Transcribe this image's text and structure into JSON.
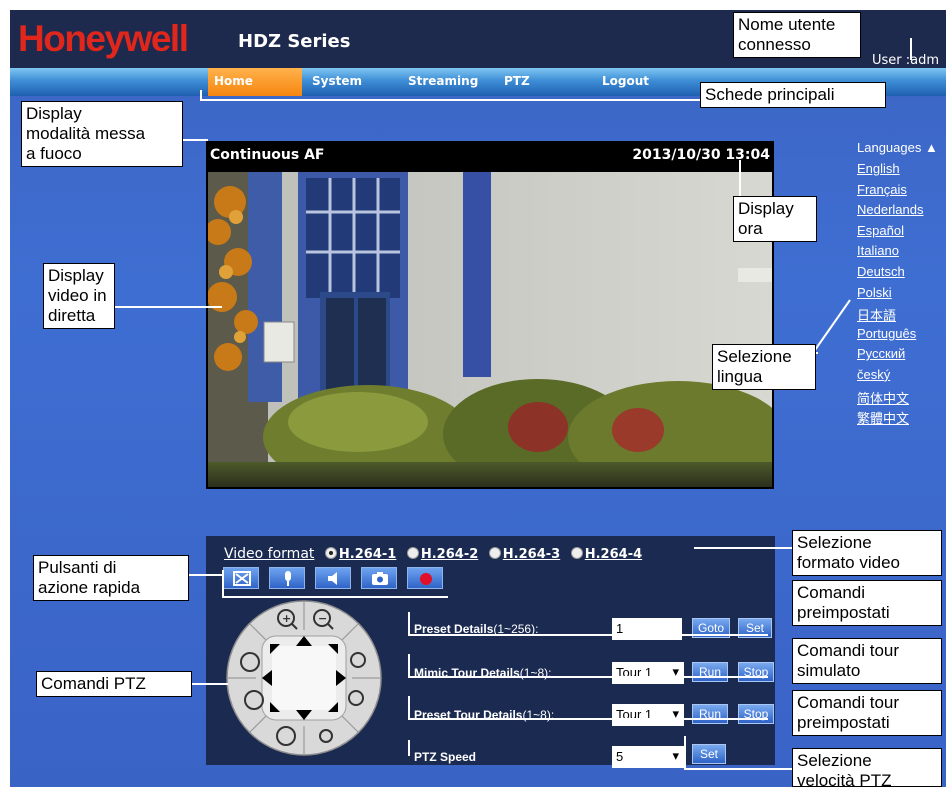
{
  "header": {
    "logo": "Honeywell",
    "series": "HDZ Series",
    "user": "User :adm"
  },
  "nav": {
    "tabs": [
      {
        "label": "Home",
        "active": true
      },
      {
        "label": "System"
      },
      {
        "label": "Streaming"
      },
      {
        "label": "PTZ"
      },
      {
        "label": "Logout"
      }
    ]
  },
  "video": {
    "focus_mode": "Continuous AF",
    "datetime": "2013/10/30 13:04"
  },
  "languages": {
    "title": "Languages",
    "items": [
      "English",
      "Français",
      "Nederlands",
      "Español",
      "Italiano",
      "Deutsch",
      "Polski",
      "日本語",
      "Português",
      "Русский",
      "český",
      "简体中文",
      "繁體中文"
    ]
  },
  "controls": {
    "video_format": {
      "label": "Video format",
      "options": [
        "H.264-1",
        "H.264-2",
        "H.264-3",
        "H.264-4"
      ],
      "selected": "H.264-1"
    },
    "quick_buttons": [
      "fullscreen-icon",
      "microphone-icon",
      "speaker-icon",
      "camera-icon",
      "record-icon"
    ],
    "preset": {
      "label": "Preset Details",
      "range": "(1~256):",
      "value": "1",
      "goto": "Goto",
      "set": "Set"
    },
    "mimic_tour": {
      "label": "Mimic Tour Details",
      "range": "(1~8):",
      "value": "Tour 1",
      "run": "Run",
      "stop": "Stop"
    },
    "preset_tour": {
      "label": "Preset Tour Details",
      "range": "(1~8):",
      "value": "Tour 1",
      "run": "Run",
      "stop": "Stop"
    },
    "ptz_speed": {
      "label": "PTZ Speed",
      "value": "5",
      "set": "Set"
    }
  },
  "callouts": {
    "user": [
      "Nome utente",
      "connesso"
    ],
    "tabs": [
      "Schede principali"
    ],
    "focus": [
      "Display",
      "modalità messa",
      "a fuoco"
    ],
    "time": [
      "Display",
      "ora"
    ],
    "live": [
      "Display",
      "video in",
      "diretta"
    ],
    "language": [
      "Selezione",
      "lingua"
    ],
    "format": [
      "Selezione",
      "formato video"
    ],
    "quick": [
      "Pulsanti di",
      "azione rapida"
    ],
    "presets": [
      "Comandi",
      "preimpostati"
    ],
    "ptz": [
      "Comandi PTZ"
    ],
    "mimic": [
      "Comandi tour",
      "simulato"
    ],
    "ptour": [
      "Comandi tour",
      "preimpostati"
    ],
    "speed": [
      "Selezione",
      "velocità PTZ"
    ]
  },
  "colors": {
    "logo_red": "#e1261c",
    "header_bg": "#1d2a4d",
    "page_blue": "#3f6ed2",
    "tab_active": "#f6860f",
    "panel_bg": "#1b2a50"
  }
}
